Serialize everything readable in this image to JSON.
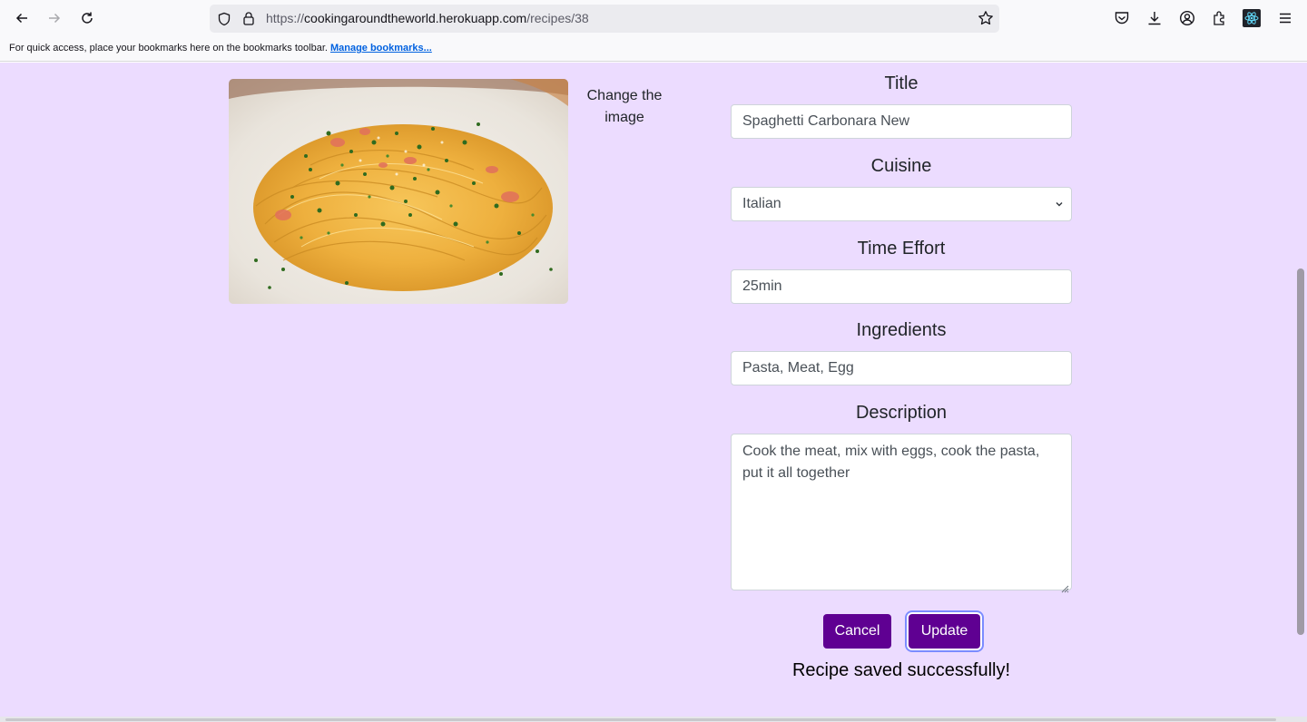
{
  "browser": {
    "url_prefix": "https://",
    "url_host": "cookingaroundtheworld.herokuapp.com",
    "url_path": "/recipes/38",
    "bookmarks_message": "For quick access, place your bookmarks here on the bookmarks toolbar.",
    "manage_bookmarks": "Manage bookmarks..."
  },
  "recipe": {
    "image_alt": "Spaghetti Carbonara",
    "change_image_label": "Change the image",
    "title_label": "Title",
    "title_value": "Spaghetti Carbonara New",
    "cuisine_label": "Cuisine",
    "cuisine_value": "Italian",
    "time_label": "Time Effort",
    "time_value": "25min",
    "ingredients_label": "Ingredients",
    "ingredients_value": "Pasta, Meat, Egg",
    "description_label": "Description",
    "description_value": "Cook the meat, mix with eggs, cook the pasta, put it all together"
  },
  "actions": {
    "cancel_label": "Cancel",
    "update_label": "Update",
    "status_message": "Recipe saved successfully!"
  },
  "colors": {
    "page_background": "#ecdcff",
    "button_primary": "#5f0092"
  }
}
